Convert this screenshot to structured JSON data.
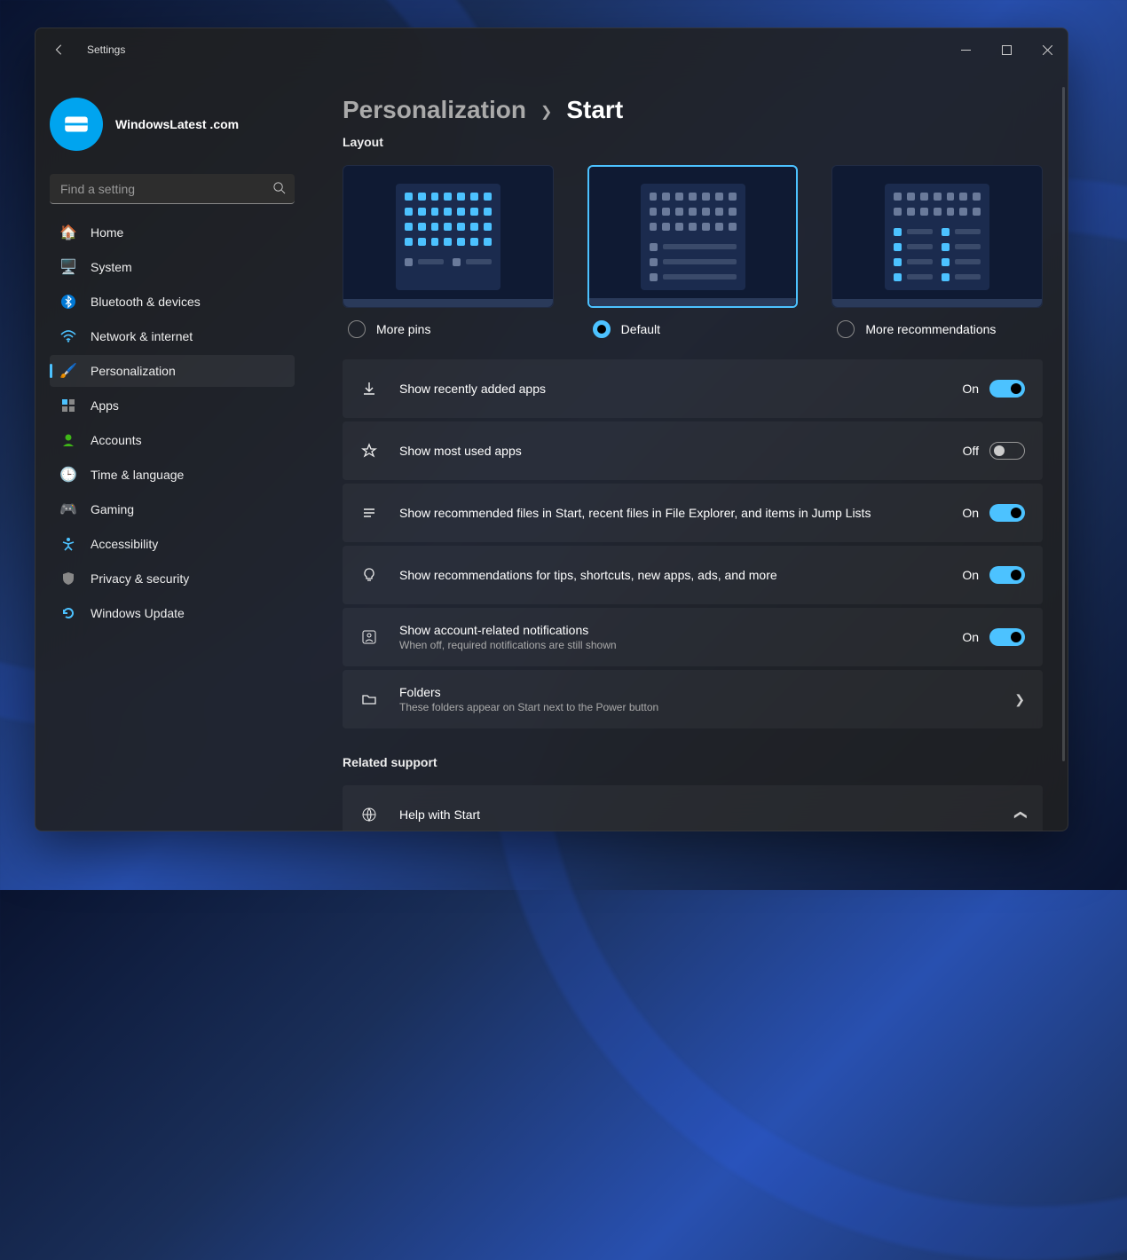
{
  "window": {
    "title": "Settings"
  },
  "profile": {
    "name": "WindowsLatest .com"
  },
  "search": {
    "placeholder": "Find a setting"
  },
  "nav": {
    "items": [
      {
        "label": "Home"
      },
      {
        "label": "System"
      },
      {
        "label": "Bluetooth & devices"
      },
      {
        "label": "Network & internet"
      },
      {
        "label": "Personalization"
      },
      {
        "label": "Apps"
      },
      {
        "label": "Accounts"
      },
      {
        "label": "Time & language"
      },
      {
        "label": "Gaming"
      },
      {
        "label": "Accessibility"
      },
      {
        "label": "Privacy & security"
      },
      {
        "label": "Windows Update"
      }
    ],
    "selected_index": 4
  },
  "breadcrumb": {
    "parent": "Personalization",
    "current": "Start"
  },
  "layout": {
    "section_label": "Layout",
    "options": [
      {
        "label": "More pins"
      },
      {
        "label": "Default"
      },
      {
        "label": "More recommendations"
      }
    ],
    "selected_index": 1
  },
  "settings": [
    {
      "title": "Show recently added apps",
      "state": "On",
      "on": true
    },
    {
      "title": "Show most used apps",
      "state": "Off",
      "on": false
    },
    {
      "title": "Show recommended files in Start, recent files in File Explorer, and items in Jump Lists",
      "state": "On",
      "on": true
    },
    {
      "title": "Show recommendations for tips, shortcuts, new apps, ads, and more",
      "state": "On",
      "on": true
    },
    {
      "title": "Show account-related notifications",
      "sub": "When off, required notifications are still shown",
      "state": "On",
      "on": true
    }
  ],
  "folders": {
    "title": "Folders",
    "sub": "These folders appear on Start next to the Power button"
  },
  "related": {
    "heading": "Related support",
    "help": "Help with Start"
  }
}
